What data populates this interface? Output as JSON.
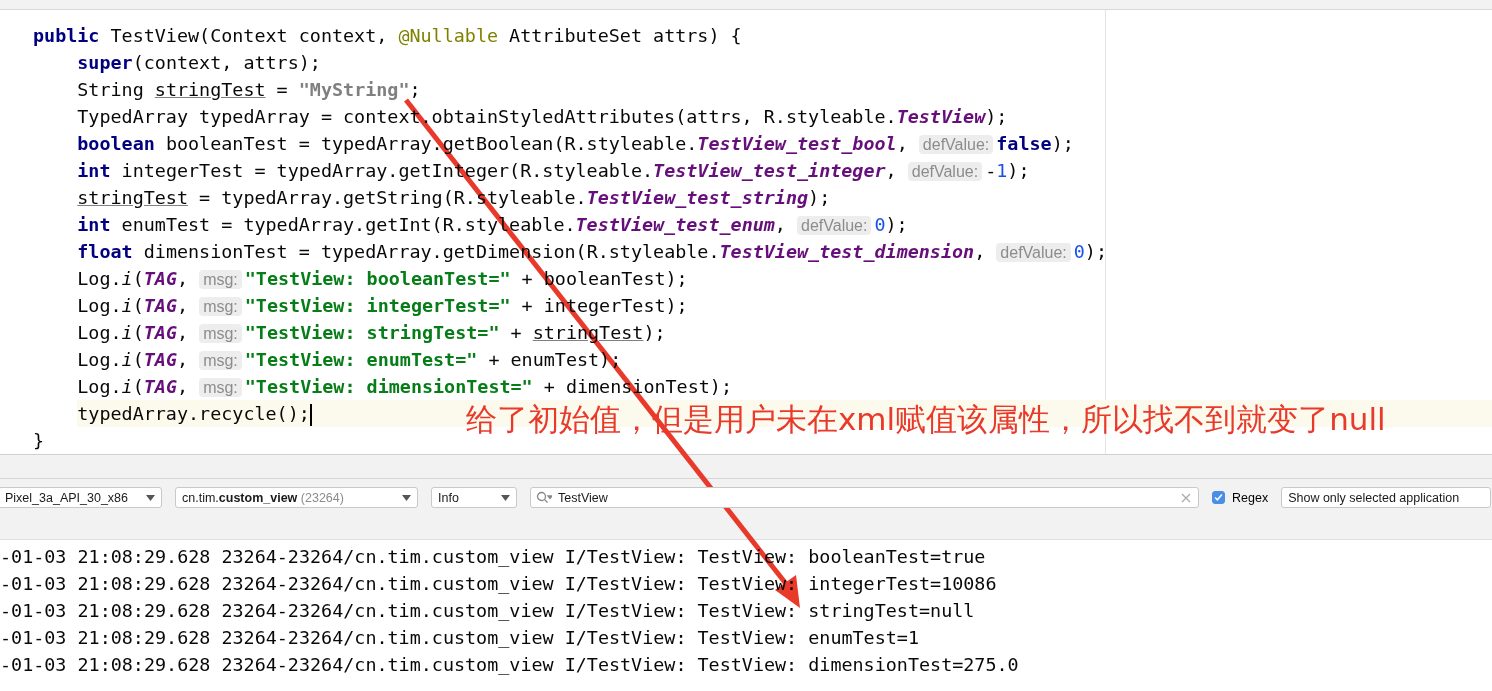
{
  "editor": {
    "lines": [
      {
        "current": false,
        "tokens": [
          {
            "text": "public",
            "kind": "kw"
          },
          {
            "text": " TestView(Context context, ",
            "kind": "plain"
          },
          {
            "text": "@Nullable",
            "kind": "ann"
          },
          {
            "text": " AttributeSet attrs) {",
            "kind": "plain"
          }
        ],
        "children": [
          {
            "current": false,
            "tokens": [
              {
                "text": "super",
                "kind": "kw"
              },
              {
                "text": "(context, attrs);",
                "kind": "plain"
              }
            ]
          },
          {
            "current": false,
            "tokens": [
              {
                "text": "String ",
                "kind": "plain"
              },
              {
                "text": "stringTest",
                "kind": "uvar"
              },
              {
                "text": " = ",
                "kind": "plain"
              },
              {
                "text": "\"MyString\"",
                "kind": "unused"
              },
              {
                "text": ";",
                "kind": "plain"
              }
            ]
          },
          {
            "current": false,
            "tokens": [
              {
                "text": "TypedArray typedArray = context.obtainStyledAttributes(attrs, R.styleable.",
                "kind": "plain"
              },
              {
                "text": "TestView",
                "kind": "field"
              },
              {
                "text": ");",
                "kind": "plain"
              }
            ]
          },
          {
            "current": false,
            "tokens": [
              {
                "text": "boolean",
                "kind": "kw"
              },
              {
                "text": " booleanTest = typedArray.getBoolean(R.styleable.",
                "kind": "plain"
              },
              {
                "text": "TestView_test_bool",
                "kind": "field"
              },
              {
                "text": ", ",
                "kind": "plain"
              },
              {
                "text": "defValue:",
                "kind": "hint"
              },
              {
                "text": "false",
                "kind": "kw"
              },
              {
                "text": ");",
                "kind": "plain"
              }
            ]
          },
          {
            "current": false,
            "tokens": [
              {
                "text": "int",
                "kind": "kw"
              },
              {
                "text": " integerTest = typedArray.getInteger(R.styleable.",
                "kind": "plain"
              },
              {
                "text": "TestView_test_integer",
                "kind": "field"
              },
              {
                "text": ", ",
                "kind": "plain"
              },
              {
                "text": "defValue:",
                "kind": "hint"
              },
              {
                "text": "-",
                "kind": "plain"
              },
              {
                "text": "1",
                "kind": "num"
              },
              {
                "text": ");",
                "kind": "plain"
              }
            ]
          },
          {
            "current": false,
            "tokens": [
              {
                "text": "stringTest",
                "kind": "uvar"
              },
              {
                "text": " = typedArray.getString(R.styleable.",
                "kind": "plain"
              },
              {
                "text": "TestView_test_string",
                "kind": "field"
              },
              {
                "text": ");",
                "kind": "plain"
              }
            ]
          },
          {
            "current": false,
            "tokens": [
              {
                "text": "int",
                "kind": "kw"
              },
              {
                "text": " enumTest = typedArray.getInt(R.styleable.",
                "kind": "plain"
              },
              {
                "text": "TestView_test_enum",
                "kind": "field"
              },
              {
                "text": ", ",
                "kind": "plain"
              },
              {
                "text": "defValue:",
                "kind": "hint"
              },
              {
                "text": "0",
                "kind": "num"
              },
              {
                "text": ");",
                "kind": "plain"
              }
            ]
          },
          {
            "current": false,
            "tokens": [
              {
                "text": "float",
                "kind": "kw"
              },
              {
                "text": " dimensionTest = typedArray.getDimension(R.styleable.",
                "kind": "plain"
              },
              {
                "text": "TestView_test_dimension",
                "kind": "field"
              },
              {
                "text": ", ",
                "kind": "plain"
              },
              {
                "text": "defValue:",
                "kind": "hint"
              },
              {
                "text": "0",
                "kind": "num"
              },
              {
                "text": ");",
                "kind": "plain"
              }
            ]
          },
          {
            "current": false,
            "tokens": [
              {
                "text": "Log.",
                "kind": "plain"
              },
              {
                "text": "i",
                "kind": "static"
              },
              {
                "text": "(",
                "kind": "plain"
              },
              {
                "text": "TAG",
                "kind": "const"
              },
              {
                "text": ", ",
                "kind": "plain"
              },
              {
                "text": "msg:",
                "kind": "hint"
              },
              {
                "text": "\"TestView: booleanTest=\"",
                "kind": "str"
              },
              {
                "text": " + booleanTest);",
                "kind": "plain"
              }
            ]
          },
          {
            "current": false,
            "tokens": [
              {
                "text": "Log.",
                "kind": "plain"
              },
              {
                "text": "i",
                "kind": "static"
              },
              {
                "text": "(",
                "kind": "plain"
              },
              {
                "text": "TAG",
                "kind": "const"
              },
              {
                "text": ", ",
                "kind": "plain"
              },
              {
                "text": "msg:",
                "kind": "hint"
              },
              {
                "text": "\"TestView: integerTest=\"",
                "kind": "str"
              },
              {
                "text": " + integerTest);",
                "kind": "plain"
              }
            ]
          },
          {
            "current": false,
            "tokens": [
              {
                "text": "Log.",
                "kind": "plain"
              },
              {
                "text": "i",
                "kind": "static"
              },
              {
                "text": "(",
                "kind": "plain"
              },
              {
                "text": "TAG",
                "kind": "const"
              },
              {
                "text": ", ",
                "kind": "plain"
              },
              {
                "text": "msg:",
                "kind": "hint"
              },
              {
                "text": "\"TestView: stringTest=\"",
                "kind": "str"
              },
              {
                "text": " + ",
                "kind": "plain"
              },
              {
                "text": "stringTest",
                "kind": "uvar"
              },
              {
                "text": ");",
                "kind": "plain"
              }
            ]
          },
          {
            "current": false,
            "tokens": [
              {
                "text": "Log.",
                "kind": "plain"
              },
              {
                "text": "i",
                "kind": "static"
              },
              {
                "text": "(",
                "kind": "plain"
              },
              {
                "text": "TAG",
                "kind": "const"
              },
              {
                "text": ", ",
                "kind": "plain"
              },
              {
                "text": "msg:",
                "kind": "hint"
              },
              {
                "text": "\"TestView: enumTest=\"",
                "kind": "str"
              },
              {
                "text": " + enumTest);",
                "kind": "plain"
              }
            ]
          },
          {
            "current": false,
            "tokens": [
              {
                "text": "Log.",
                "kind": "plain"
              },
              {
                "text": "i",
                "kind": "static"
              },
              {
                "text": "(",
                "kind": "plain"
              },
              {
                "text": "TAG",
                "kind": "const"
              },
              {
                "text": ", ",
                "kind": "plain"
              },
              {
                "text": "msg:",
                "kind": "hint"
              },
              {
                "text": "\"TestView: dimensionTest=\"",
                "kind": "str"
              },
              {
                "text": " + dimensionTest);",
                "kind": "plain"
              }
            ]
          },
          {
            "current": true,
            "tokens": [
              {
                "text": "typedArray.recycle();",
                "kind": "plain"
              }
            ]
          }
        ]
      },
      {
        "current": false,
        "tokens": [
          {
            "text": "}",
            "kind": "plain"
          }
        ]
      }
    ]
  },
  "annotation": {
    "text": "给了初始值，但是用户未在xml赋值该属性，所以找不到就变了null"
  },
  "logcat": {
    "toolbar": {
      "device": "Pixel_3a_API_30_x86",
      "process": {
        "prefix": "cn.tim.",
        "name": "custom_view",
        "pid": "(23264)"
      },
      "level": "Info",
      "search": {
        "value": "TestView"
      },
      "regex": {
        "label": "Regex",
        "checked": true
      },
      "filter": "Show only selected application"
    },
    "lines": [
      "-01-03 21:08:29.628 23264-23264/cn.tim.custom_view I/TestView: TestView: booleanTest=true",
      "-01-03 21:08:29.628 23264-23264/cn.tim.custom_view I/TestView: TestView: integerTest=10086",
      "-01-03 21:08:29.628 23264-23264/cn.tim.custom_view I/TestView: TestView: stringTest=null",
      "-01-03 21:08:29.628 23264-23264/cn.tim.custom_view I/TestView: TestView: enumTest=1",
      "-01-03 21:08:29.628 23264-23264/cn.tim.custom_view I/TestView: TestView: dimensionTest=275.0"
    ]
  }
}
